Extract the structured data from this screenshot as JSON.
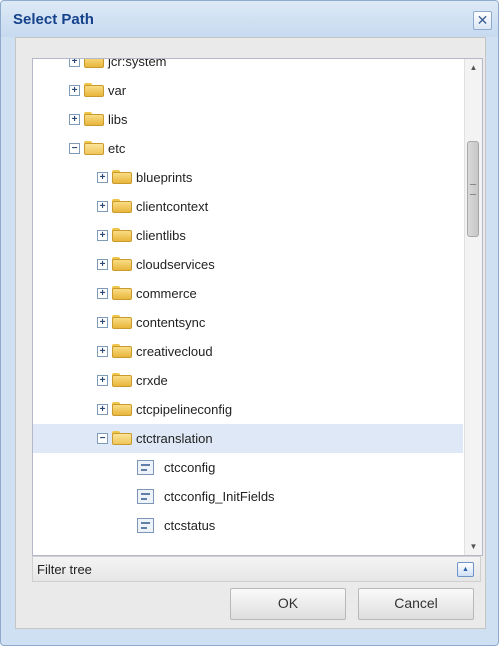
{
  "dialog": {
    "title": "Select Path",
    "close_glyph": "✕"
  },
  "tree": {
    "nodes": [
      {
        "label": "jcr:system",
        "depth": 0,
        "kind": "folder",
        "toggle": "plus"
      },
      {
        "label": "var",
        "depth": 0,
        "kind": "folder",
        "toggle": "plus"
      },
      {
        "label": "libs",
        "depth": 0,
        "kind": "folder",
        "toggle": "plus"
      },
      {
        "label": "etc",
        "depth": 0,
        "kind": "folder-open",
        "toggle": "minus"
      },
      {
        "label": "blueprints",
        "depth": 1,
        "kind": "folder",
        "toggle": "plus"
      },
      {
        "label": "clientcontext",
        "depth": 1,
        "kind": "folder",
        "toggle": "plus"
      },
      {
        "label": "clientlibs",
        "depth": 1,
        "kind": "folder",
        "toggle": "plus"
      },
      {
        "label": "cloudservices",
        "depth": 1,
        "kind": "folder",
        "toggle": "plus"
      },
      {
        "label": "commerce",
        "depth": 1,
        "kind": "folder",
        "toggle": "plus"
      },
      {
        "label": "contentsync",
        "depth": 1,
        "kind": "folder",
        "toggle": "plus"
      },
      {
        "label": "creativecloud",
        "depth": 1,
        "kind": "folder",
        "toggle": "plus"
      },
      {
        "label": "crxde",
        "depth": 1,
        "kind": "folder",
        "toggle": "plus"
      },
      {
        "label": "ctcpipelineconfig",
        "depth": 1,
        "kind": "folder",
        "toggle": "plus"
      },
      {
        "label": "ctctranslation",
        "depth": 1,
        "kind": "folder-open",
        "toggle": "minus",
        "selected": true
      },
      {
        "label": "ctcconfig",
        "depth": 2,
        "kind": "file"
      },
      {
        "label": "ctcconfig_InitFields",
        "depth": 2,
        "kind": "file"
      },
      {
        "label": "ctcstatus",
        "depth": 2,
        "kind": "file"
      }
    ]
  },
  "scrollbar": {
    "up_glyph": "▲",
    "down_glyph": "▼",
    "position": 0.25
  },
  "filter": {
    "label": "Filter tree",
    "toggle_glyph": "▲"
  },
  "buttons": {
    "ok": "OK",
    "cancel": "Cancel"
  }
}
